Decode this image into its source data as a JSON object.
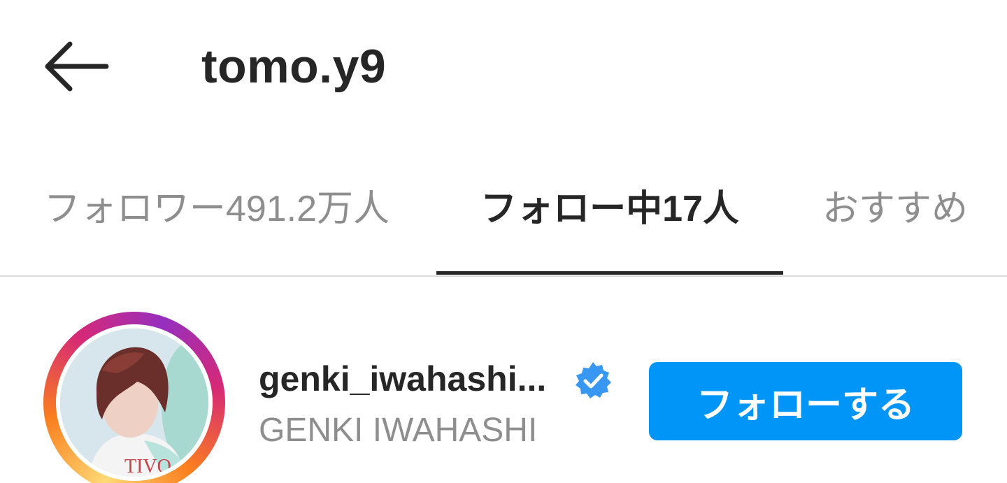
{
  "header": {
    "title": "tomo.y9"
  },
  "tabs": [
    {
      "label": "フォロワー491.2万人",
      "active": false
    },
    {
      "label": "フォロー中17人",
      "active": true
    },
    {
      "label": "おすすめ",
      "active": false
    }
  ],
  "users": [
    {
      "username": "genki_iwahashi...",
      "full_name": "GENKI IWAHASHI",
      "verified": true,
      "follow_label": "フォローする"
    }
  ],
  "colors": {
    "accent": "#0095f6",
    "text_primary": "#262626",
    "text_secondary": "#8e8e8e",
    "verified": "#3897f0"
  }
}
